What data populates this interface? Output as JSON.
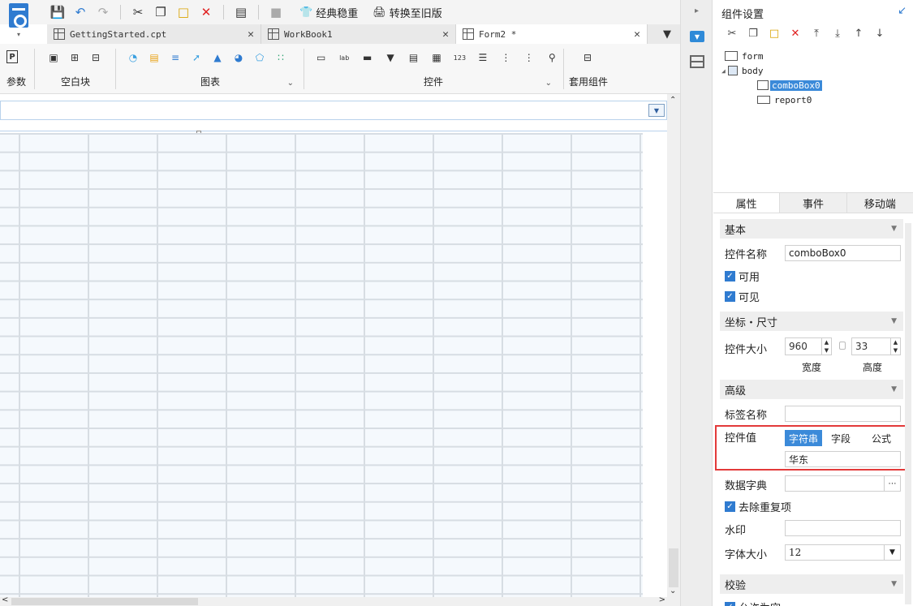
{
  "toolbar": {
    "classic_label": "经典稳重",
    "convert_label": "转换至旧版"
  },
  "tabs": [
    {
      "label": "GettingStarted.cpt"
    },
    {
      "label": "WorkBook1"
    },
    {
      "label": "Form2 *"
    }
  ],
  "ribbon": {
    "param_label": "参数",
    "blank_label": "空白块",
    "chart_label": "图表",
    "control_label": "控件",
    "template_label": "套用组件"
  },
  "panel": {
    "title": "组件设置",
    "tree": {
      "form": "form",
      "body": "body",
      "combo": "comboBox0",
      "report": "report0"
    },
    "tabs": [
      "属性",
      "事件",
      "移动端"
    ],
    "sections": {
      "basic": "基本",
      "coords": "坐标・尺寸",
      "advanced": "高级",
      "validate": "校验"
    },
    "control_name_label": "控件名称",
    "control_name_value": "comboBox0",
    "enabled_label": "可用",
    "visible_label": "可见",
    "size_label": "控件大小",
    "width_value": "960",
    "height_value": "33",
    "width_label": "宽度",
    "height_label": "高度",
    "tag_name_label": "标签名称",
    "control_value_label": "控件值",
    "value_types": [
      "字符串",
      "字段",
      "公式"
    ],
    "control_value": "华东",
    "dict_label": "数据字典",
    "dedupe_label": "去除重复项",
    "watermark_label": "水印",
    "font_size_label": "字体大小",
    "font_size_value": "12",
    "allow_empty_label": "允许为空"
  }
}
